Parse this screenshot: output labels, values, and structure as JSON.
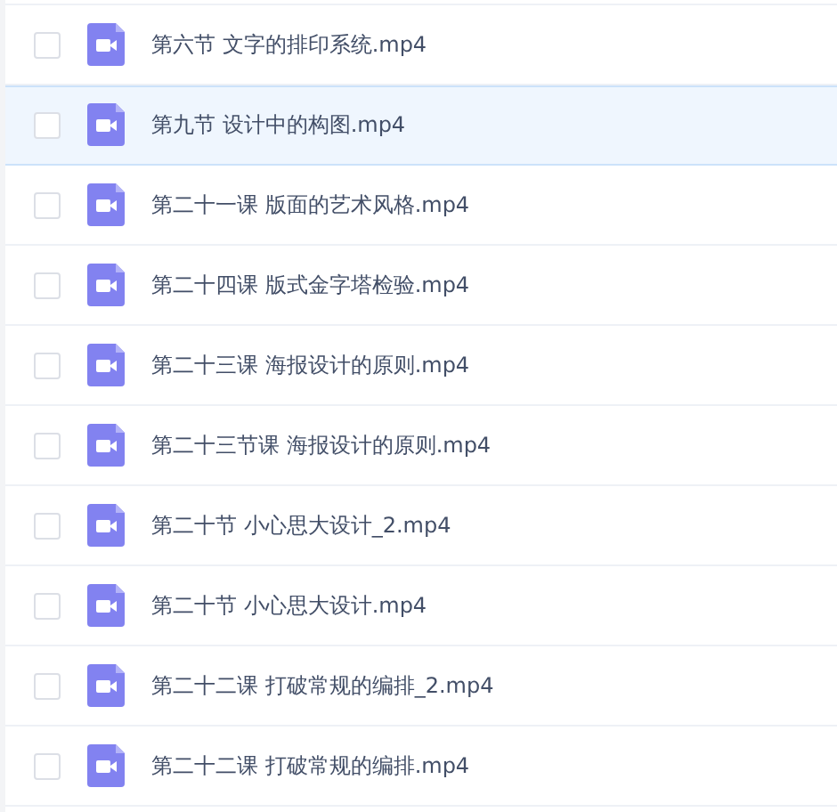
{
  "files": [
    {
      "name": "第六节 文字的排印系统.mp4",
      "checked": false,
      "selected": false
    },
    {
      "name": "第九节 设计中的构图.mp4",
      "checked": false,
      "selected": true
    },
    {
      "name": "第二十一课 版面的艺术风格.mp4",
      "checked": false,
      "selected": false
    },
    {
      "name": "第二十四课 版式金字塔检验.mp4",
      "checked": false,
      "selected": false
    },
    {
      "name": "第二十三课 海报设计的原则.mp4",
      "checked": false,
      "selected": false
    },
    {
      "name": "第二十三节课 海报设计的原则.mp4",
      "checked": false,
      "selected": false
    },
    {
      "name": "第二十节 小心思大设计_2.mp4",
      "checked": false,
      "selected": false
    },
    {
      "name": "第二十节 小心思大设计.mp4",
      "checked": false,
      "selected": false
    },
    {
      "name": "第二十二课 打破常规的编排_2.mp4",
      "checked": false,
      "selected": false
    },
    {
      "name": "第二十二课 打破常规的编排.mp4",
      "checked": false,
      "selected": false
    }
  ]
}
